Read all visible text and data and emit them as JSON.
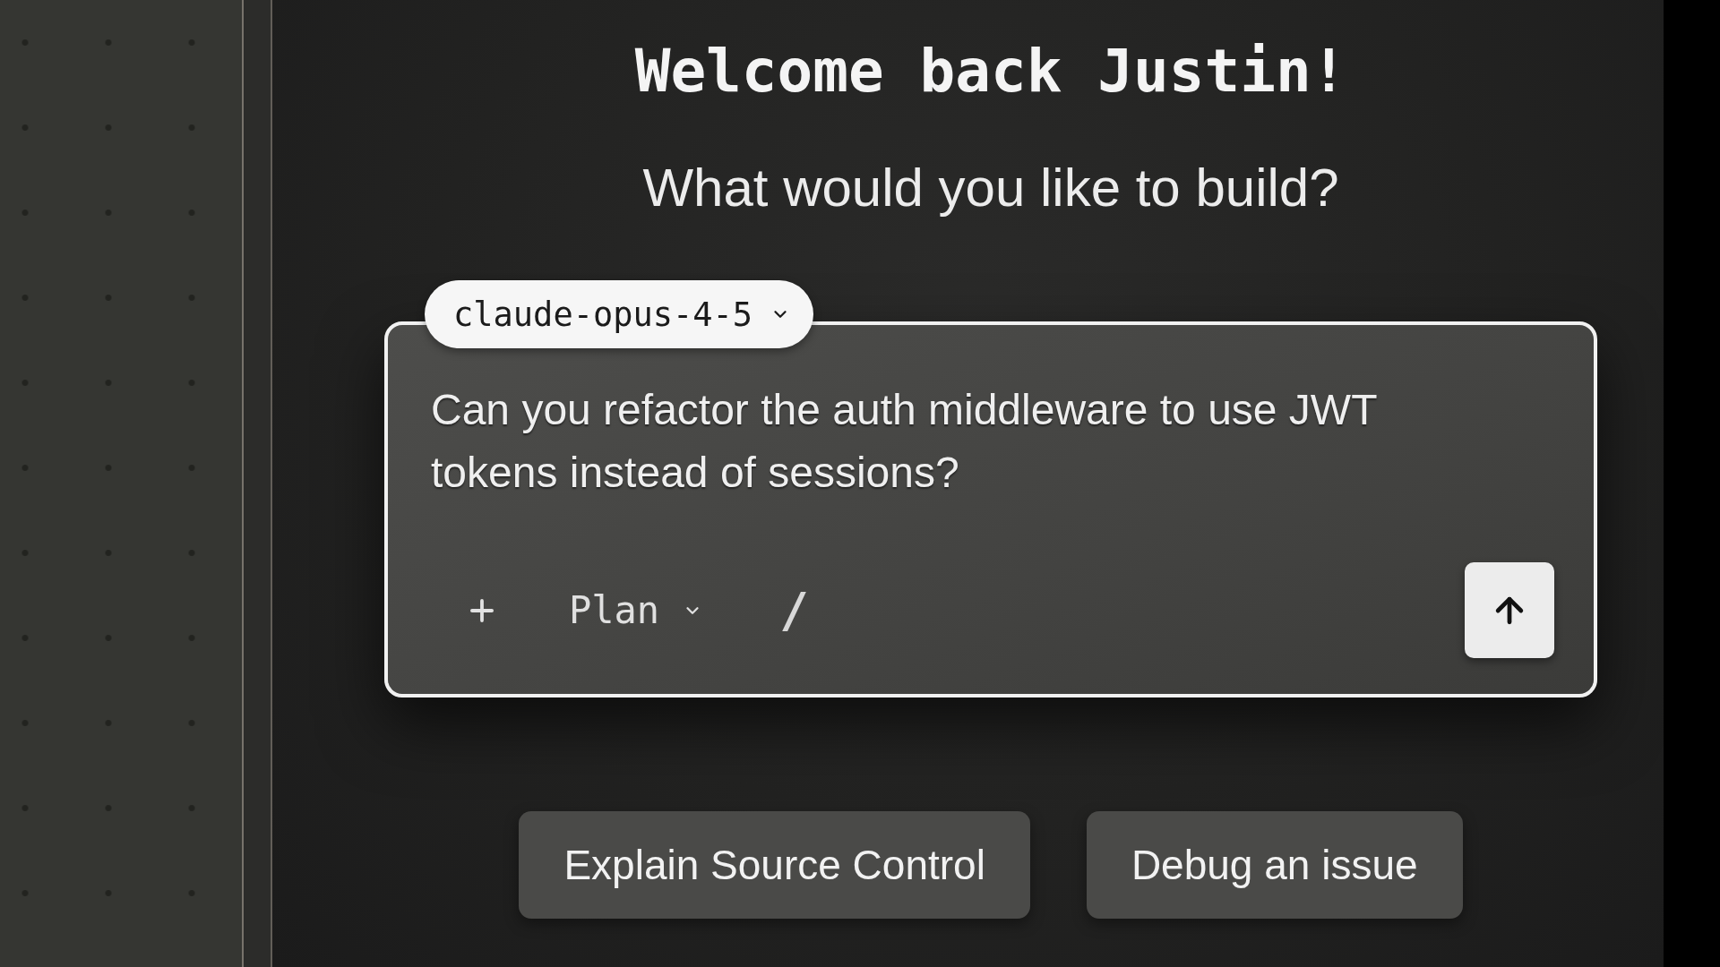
{
  "heading": "Welcome back Justin!",
  "subheading": "What would you like to build?",
  "composer": {
    "model": "claude-opus-4-5",
    "prompt": "Can you refactor the auth middleware to use JWT tokens instead of sessions?",
    "mode": "Plan",
    "command_key": "/"
  },
  "suggestions": [
    {
      "label": "Explain Source Control"
    },
    {
      "label": "Debug an issue"
    }
  ]
}
